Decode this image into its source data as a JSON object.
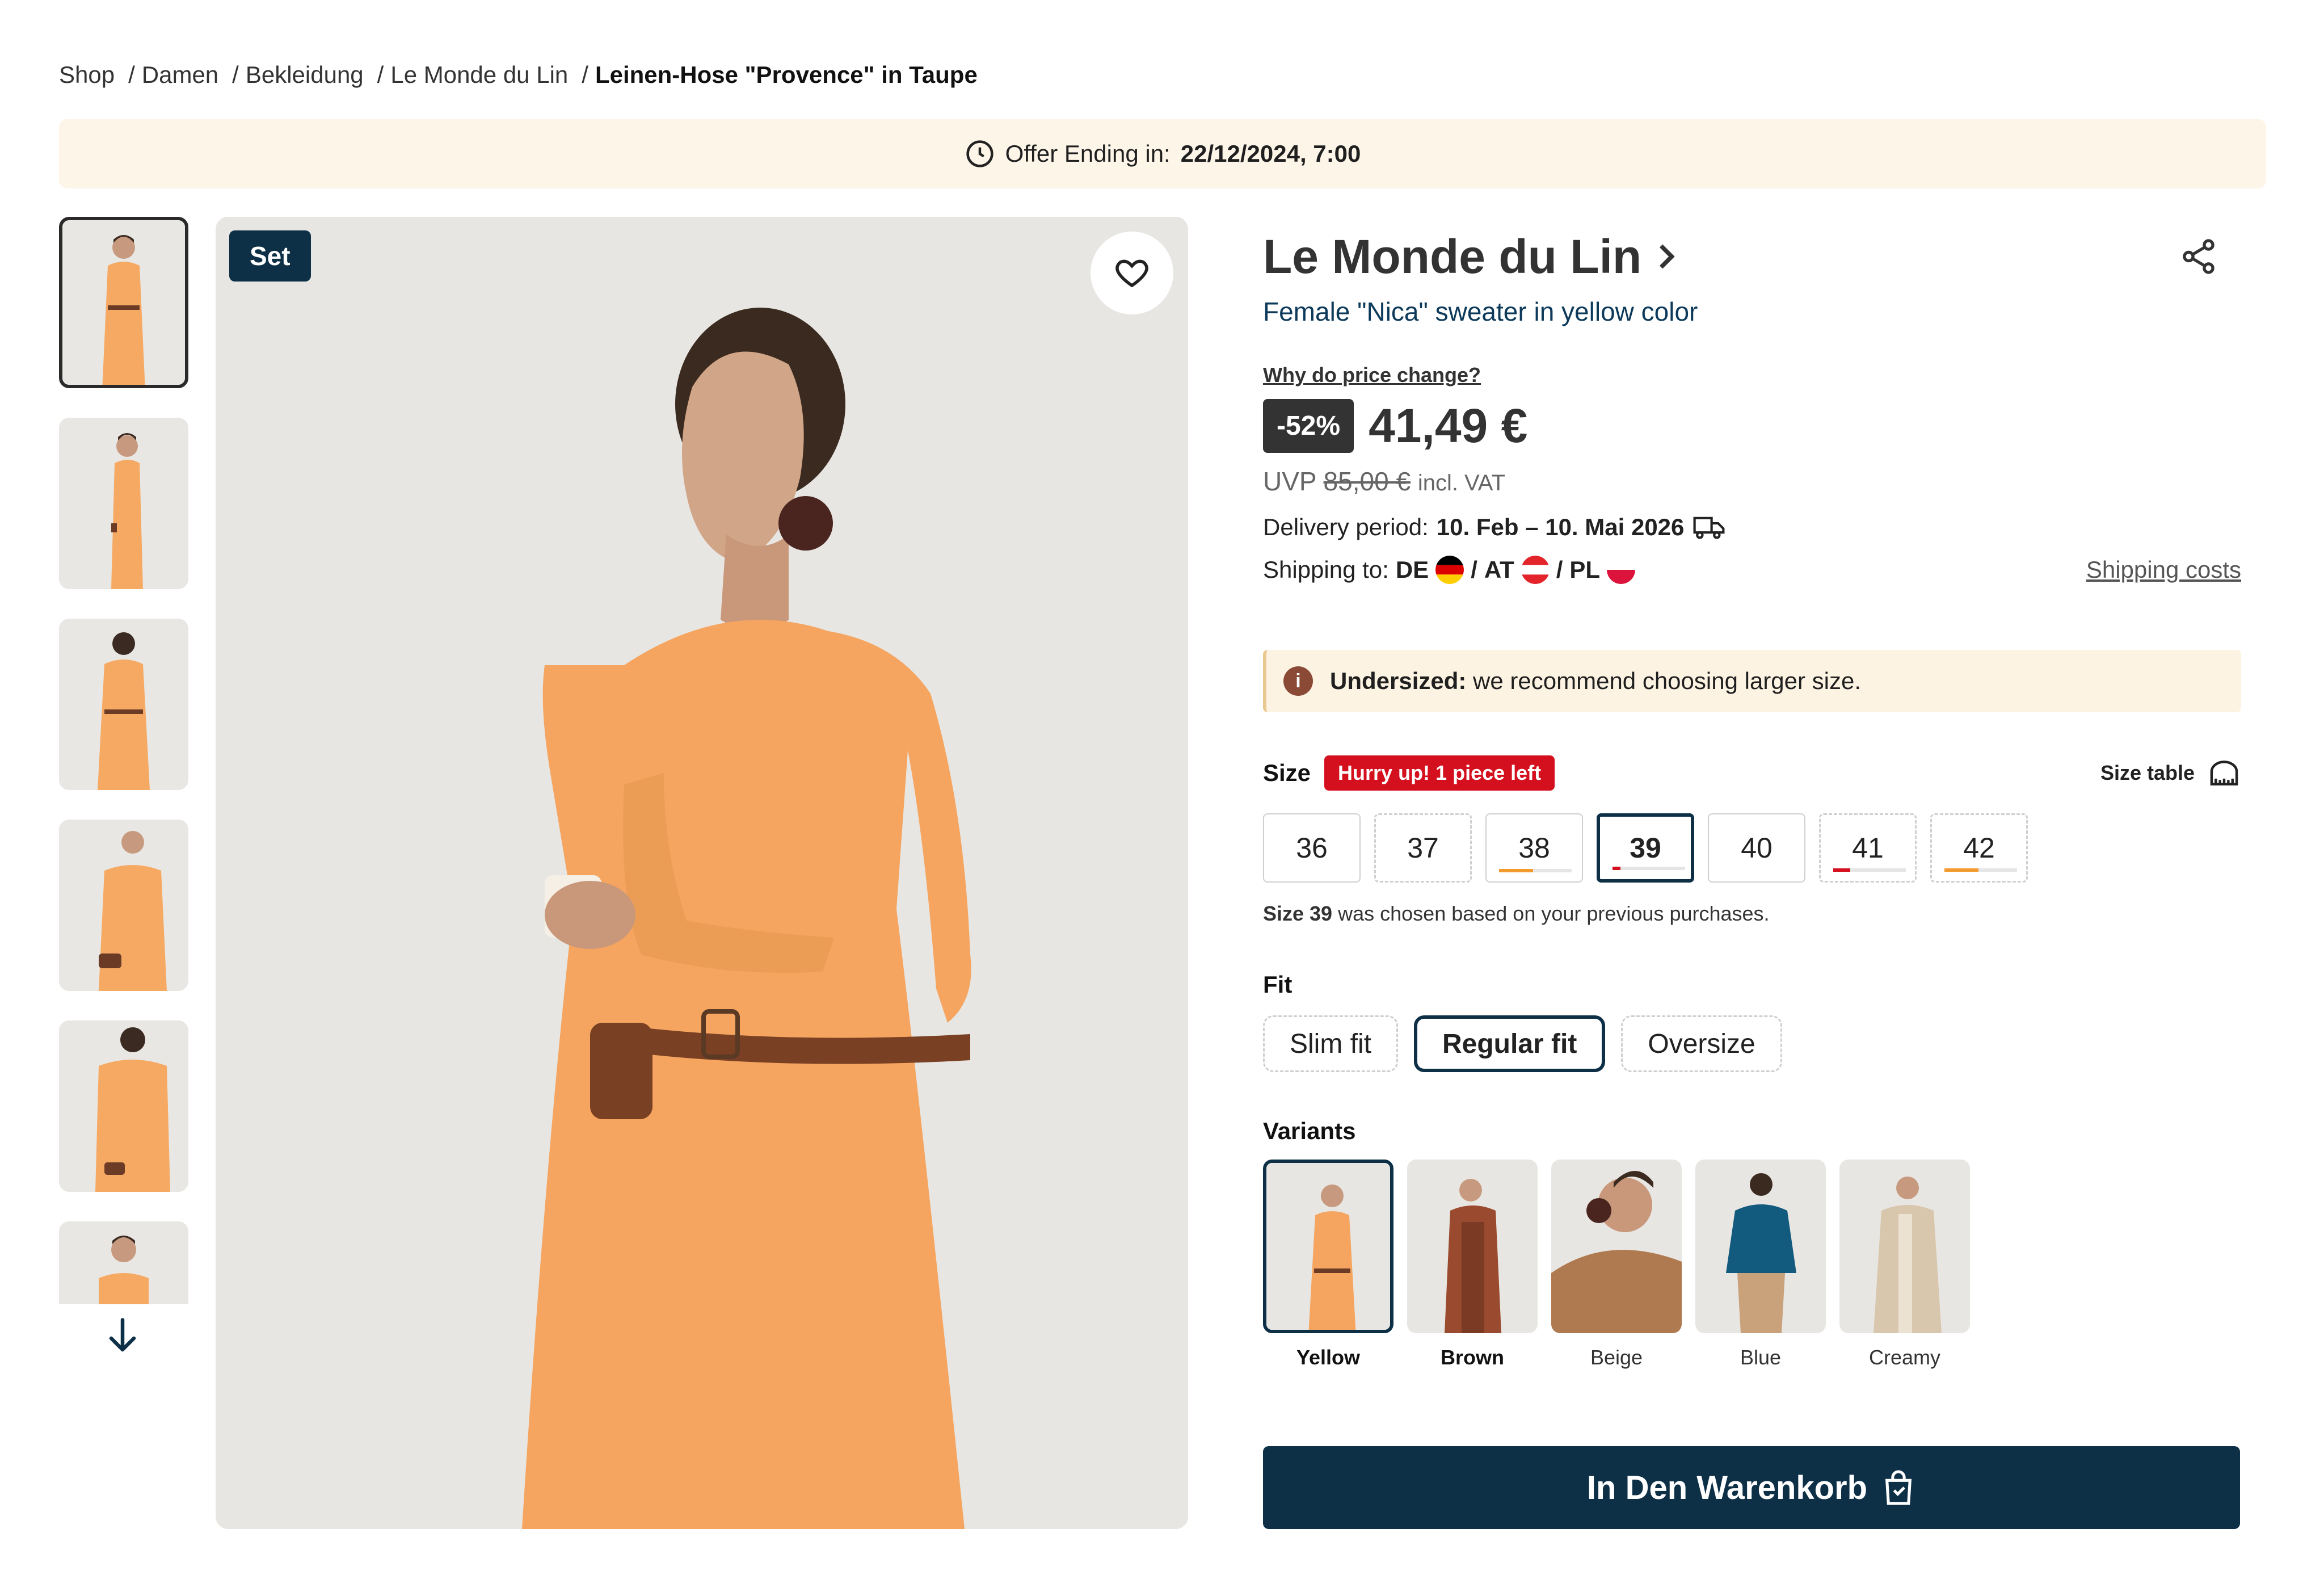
{
  "breadcrumb": [
    "Shop",
    "Damen",
    "Bekleidung",
    "Le Monde du Lin"
  ],
  "breadcrumb_current": "Leinen-Hose \"Provence\" in Taupe",
  "offer": {
    "label": "Offer Ending in:",
    "value": "22/12/2024, 7:00"
  },
  "gallery": {
    "badge": "Set",
    "thumb_count": 6
  },
  "product": {
    "brand": "Le Monde du Lin",
    "subtitle": "Female \"Nica\" sweater in yellow color",
    "why_price": "Why do price change?",
    "discount": "-52%",
    "price": "41,49 €",
    "uvp_label": "UVP",
    "uvp_old": "85,00 €",
    "vat": "incl. VAT",
    "delivery_label": "Delivery period:",
    "delivery_value": "10. Feb – 10. Mai 2026",
    "shipping_label": "Shipping to:",
    "shipping": [
      "DE",
      "AT",
      "PL"
    ],
    "shipping_costs": "Shipping costs"
  },
  "warning": {
    "strong": "Undersized:",
    "text": "we recommend choosing larger size."
  },
  "size": {
    "label": "Size",
    "hurry": "Hurry up! 1 piece left",
    "table": "Size table",
    "options": [
      "36",
      "37",
      "38",
      "39",
      "40",
      "41",
      "42"
    ],
    "selected": "39",
    "note_size": "Size 39",
    "note_text": "was chosen based on your previous purchases."
  },
  "fit": {
    "label": "Fit",
    "options": [
      "Slim fit",
      "Regular fit",
      "Oversize"
    ],
    "selected": "Regular fit"
  },
  "variants": {
    "label": "Variants",
    "items": [
      "Yellow",
      "Brown",
      "Beige",
      "Blue",
      "Creamy"
    ]
  },
  "cart": {
    "label": "In Den Warenkorb"
  },
  "colors": {
    "navy": "#0d3047",
    "red": "#d40f1e",
    "orange": "#f5a560",
    "offer_bg": "#fdf5e8"
  }
}
